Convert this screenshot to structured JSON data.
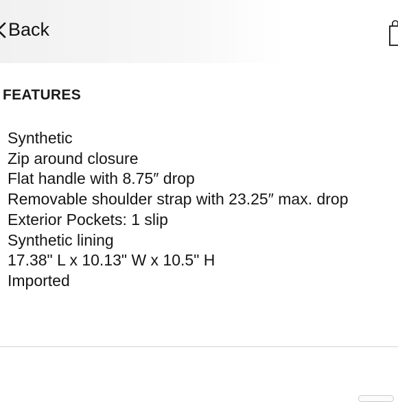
{
  "nav": {
    "back_label": "Back",
    "back_icon": "chevron-left-icon",
    "bag_icon": "shopping-bag-icon"
  },
  "section": {
    "title": "FEATURES"
  },
  "features": [
    "Synthetic",
    "Zip around closure",
    "Flat handle with 8.75″ drop",
    "Removable shoulder strap with 23.25″ max. drop",
    "Exterior Pockets: 1 slip",
    "Synthetic lining",
    "17.38\" L x 10.13\" W x 10.5\" H",
    "Imported"
  ],
  "colors": {
    "text": "#111111",
    "topbar": "#f1f1f1",
    "divider": "#d2d2d2"
  }
}
